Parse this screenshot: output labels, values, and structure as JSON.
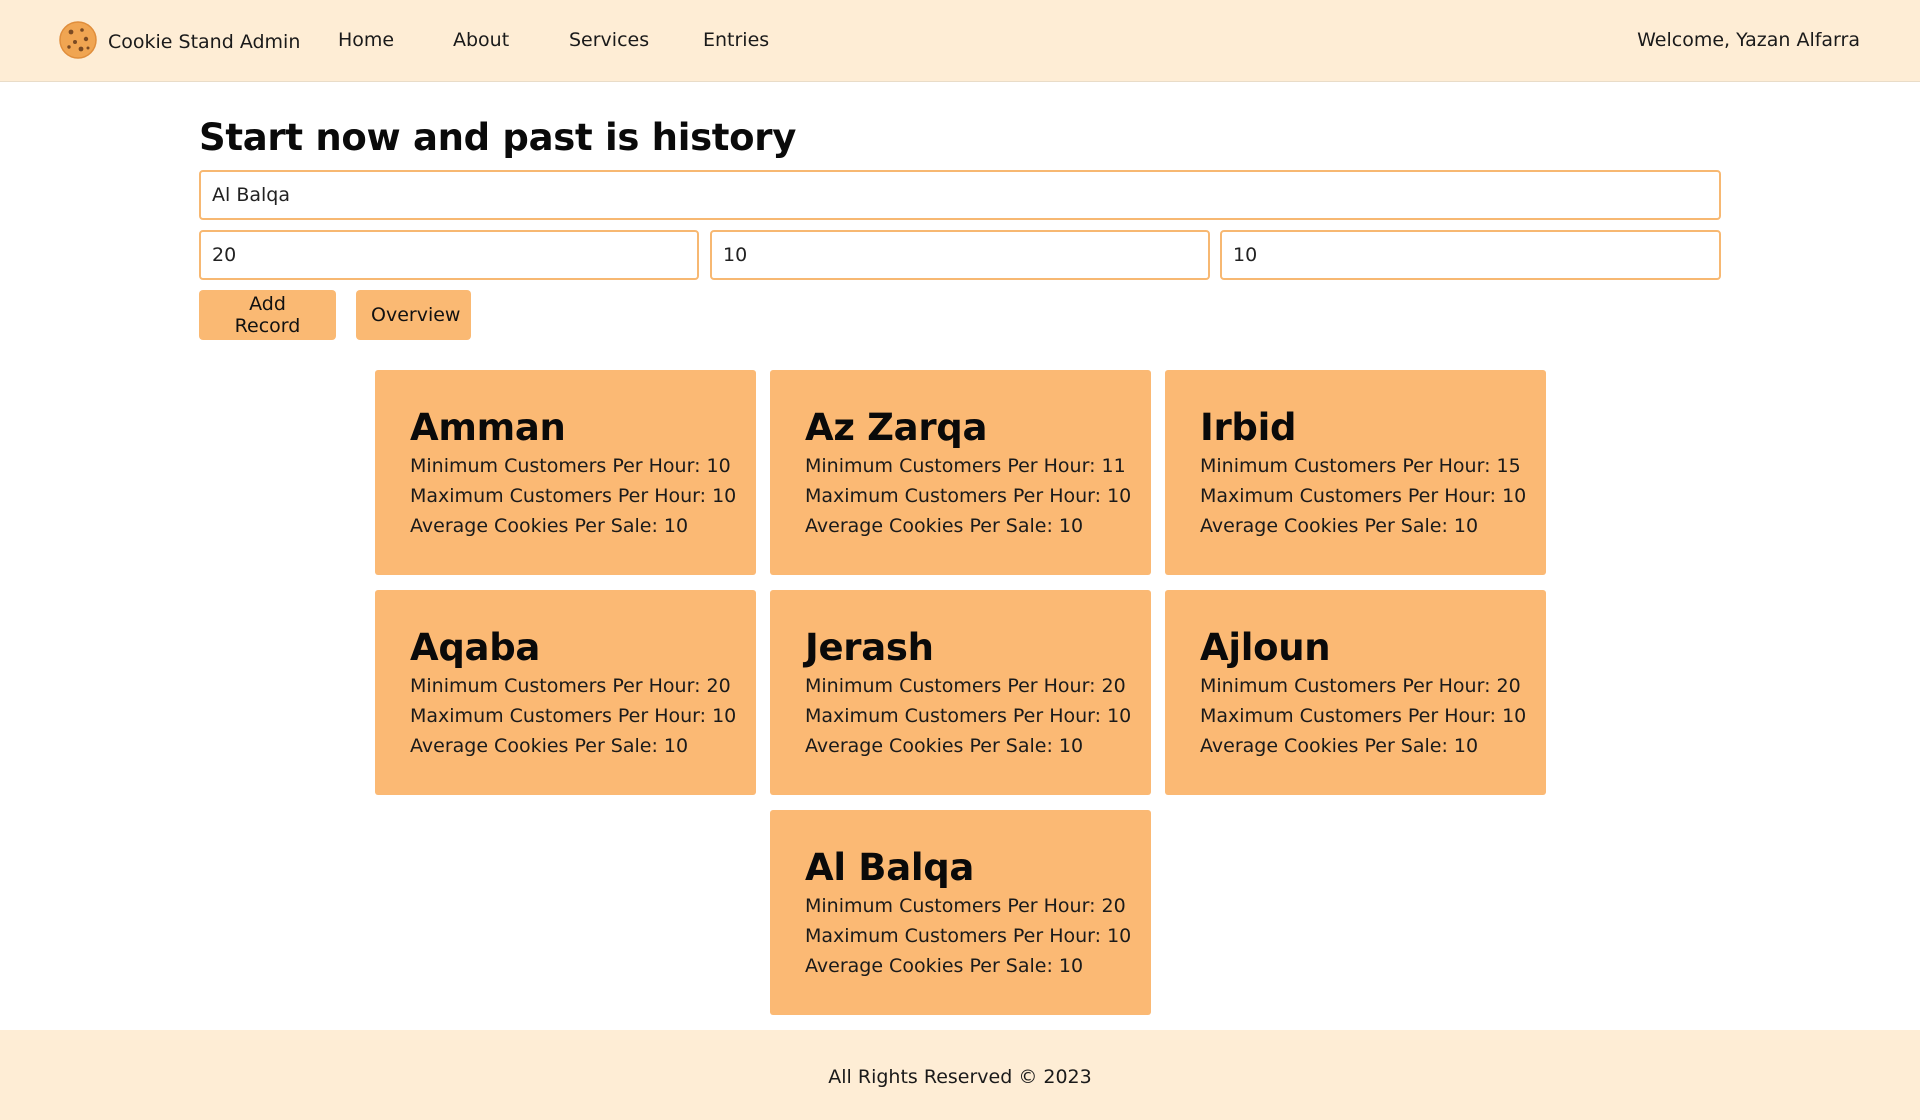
{
  "nav": {
    "brand": "Cookie Stand Admin",
    "links": [
      "Home",
      "About",
      "Services",
      "Entries"
    ],
    "welcome": "Welcome, Yazan Alfarra",
    "logo_icon": "cookie-icon"
  },
  "form": {
    "title": "Start now and past is history",
    "location_value": "Al Balqa",
    "min_value": "20",
    "max_value": "10",
    "avg_value": "10",
    "add_label": "Add Record",
    "overview_label": "Overview"
  },
  "labels": {
    "min": "Minimum Customers Per Hour: ",
    "max": "Maximum Customers Per Hour: ",
    "avg": "Average Cookies Per Sale: "
  },
  "stands": [
    {
      "location": "Amman",
      "min": 10,
      "max": 10,
      "avg": 10
    },
    {
      "location": "Az Zarqa",
      "min": 11,
      "max": 10,
      "avg": 10
    },
    {
      "location": "Irbid",
      "min": 15,
      "max": 10,
      "avg": 10
    },
    {
      "location": "Aqaba",
      "min": 20,
      "max": 10,
      "avg": 10
    },
    {
      "location": "Jerash",
      "min": 20,
      "max": 10,
      "avg": 10
    },
    {
      "location": "Ajloun",
      "min": 20,
      "max": 10,
      "avg": 10
    },
    {
      "location": "Al Balqa",
      "min": 20,
      "max": 10,
      "avg": 10
    }
  ],
  "footer": {
    "text": "All Rights Reserved © 2023"
  },
  "colors": {
    "header_bg": "#feedd5",
    "card_bg": "#fbb974",
    "button_bg": "#fab973",
    "input_border": "#f7b872"
  }
}
